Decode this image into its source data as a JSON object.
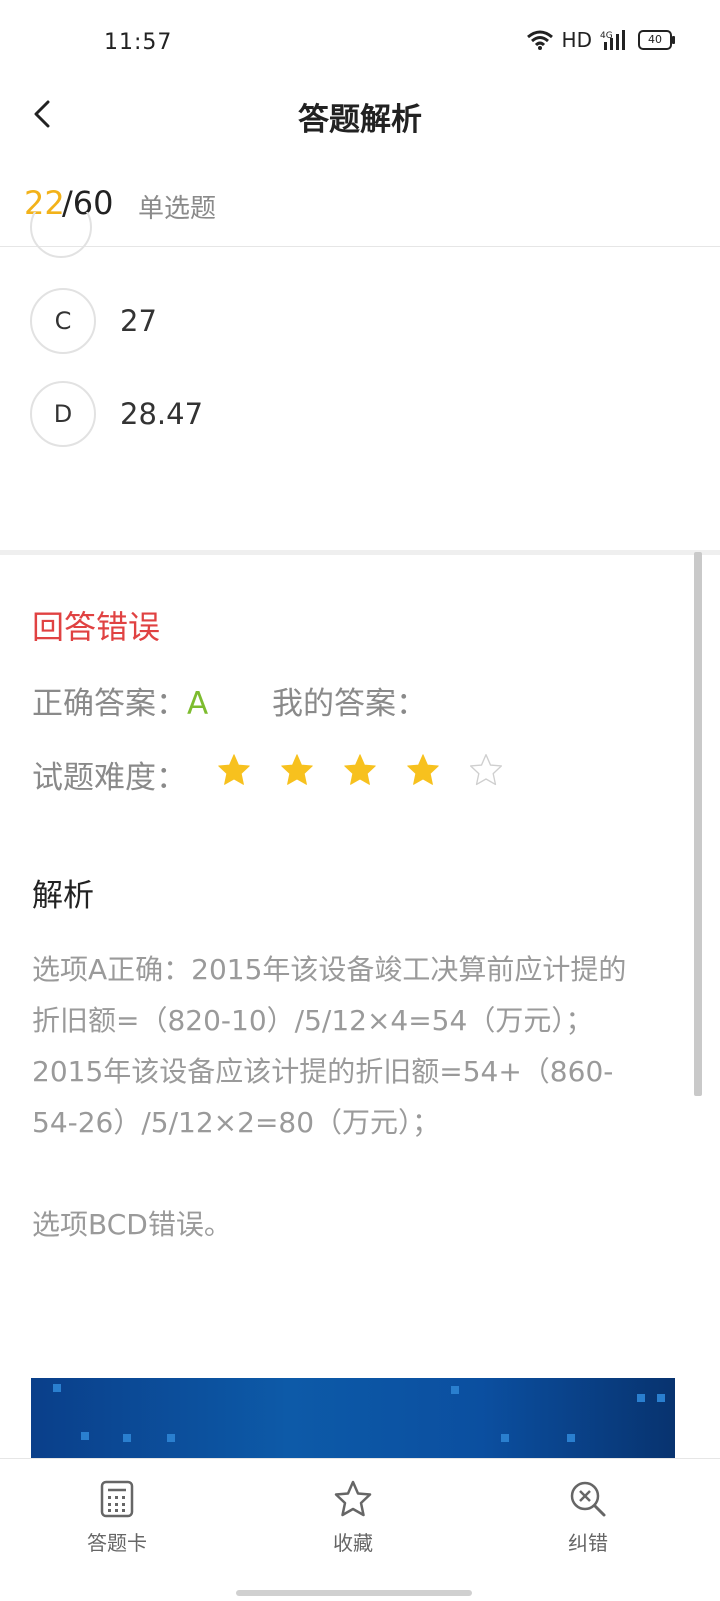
{
  "status_bar": {
    "time": "11:57",
    "network": "HD",
    "signal": "4G",
    "battery": "40"
  },
  "header": {
    "title": "答题解析",
    "back_icon": "chevron-left-icon"
  },
  "progress": {
    "current": "22",
    "total": "/60",
    "type": "单选题"
  },
  "options": [
    {
      "letter": "C",
      "text": "27"
    },
    {
      "letter": "D",
      "text": "28.47"
    }
  ],
  "result": {
    "status": "回答错误",
    "correct_label": "正确答案：",
    "correct_value": "A",
    "my_answer_label": "我的答案：",
    "my_answer_value": "",
    "difficulty_label": "试题难度：",
    "difficulty_rating": 4,
    "difficulty_max": 5
  },
  "analysis": {
    "title": "解析",
    "paragraph1": "选项A正确：2015年该设备竣工决算前应计提的折旧额=（820-10）/5/12×4=54（万元）；2015年该设备应该计提的折旧额=54+（860-54-26）/5/12×2=80（万元）；",
    "paragraph2": "选项BCD错误。"
  },
  "bottom_nav": [
    {
      "label": "答题卡",
      "icon": "answer-card-icon"
    },
    {
      "label": "收藏",
      "icon": "star-outline-icon"
    },
    {
      "label": "纠错",
      "icon": "error-search-icon"
    }
  ],
  "colors": {
    "accent": "#f2b21a",
    "error": "#e04242",
    "correct": "#7dbc2f",
    "star": "#f7c11e"
  }
}
